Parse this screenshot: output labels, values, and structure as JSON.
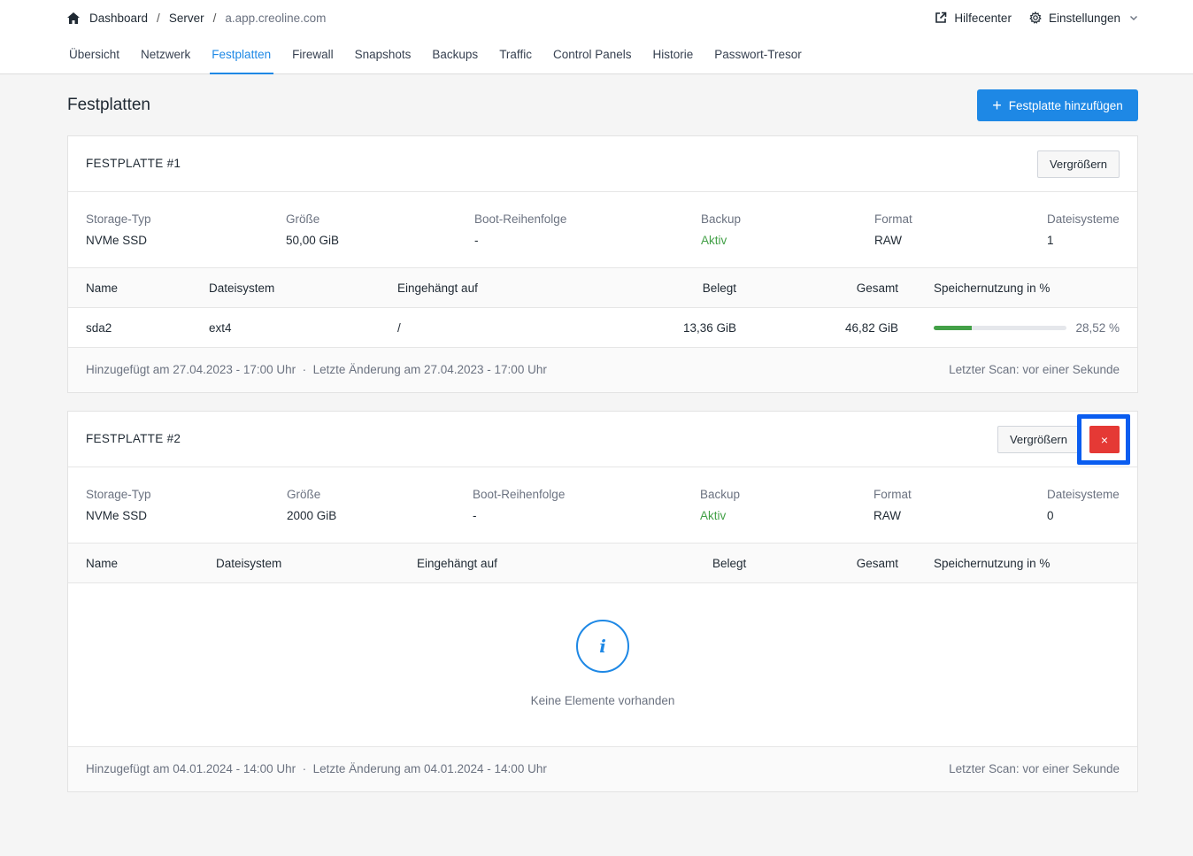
{
  "breadcrumb": {
    "home": "Dashboard",
    "section": "Server",
    "current": "a.app.creoline.com"
  },
  "header": {
    "help": "Hilfecenter",
    "settings": "Einstellungen"
  },
  "tabs": [
    {
      "label": "Übersicht"
    },
    {
      "label": "Netzwerk"
    },
    {
      "label": "Festplatten",
      "active": true
    },
    {
      "label": "Firewall"
    },
    {
      "label": "Snapshots"
    },
    {
      "label": "Backups"
    },
    {
      "label": "Traffic"
    },
    {
      "label": "Control Panels"
    },
    {
      "label": "Historie"
    },
    {
      "label": "Passwort-Tresor"
    }
  ],
  "page": {
    "title": "Festplatten",
    "add_button": "Festplatte hinzufügen"
  },
  "labels": {
    "storage_type": "Storage-Typ",
    "size": "Größe",
    "boot_order": "Boot-Reihenfolge",
    "backup": "Backup",
    "format": "Format",
    "filesystems": "Dateisysteme",
    "resize": "Vergrößern",
    "delete": "×",
    "col_name": "Name",
    "col_fs": "Dateisystem",
    "col_mount": "Eingehängt auf",
    "col_used": "Belegt",
    "col_total": "Gesamt",
    "col_usage": "Speichernutzung in %",
    "empty": "Keine Elemente vorhanden"
  },
  "disks": [
    {
      "title": "FESTPLATTE #1",
      "storage_type": "NVMe SSD",
      "size": "50,00 GiB",
      "boot_order": "-",
      "backup": "Aktiv",
      "format": "RAW",
      "filesystems": "1",
      "rows": [
        {
          "name": "sda2",
          "fs": "ext4",
          "mount": "/",
          "used": "13,36 GiB",
          "total": "46,82 GiB",
          "usage_text": "28,52 %",
          "usage": 28.52
        }
      ],
      "added": "Hinzugefügt am 27.04.2023 - 17:00 Uhr  ·  Letzte Änderung am 27.04.2023 - 17:00 Uhr",
      "scan": "Letzter Scan: vor einer Sekunde"
    },
    {
      "title": "FESTPLATTE #2",
      "storage_type": "NVMe SSD",
      "size": "2000 GiB",
      "boot_order": "-",
      "backup": "Aktiv",
      "format": "RAW",
      "filesystems": "0",
      "rows": [],
      "added": "Hinzugefügt am 04.01.2024 - 14:00 Uhr  ·  Letzte Änderung am 04.01.2024 - 14:00 Uhr",
      "scan": "Letzter Scan: vor einer Sekunde"
    }
  ],
  "colors": {
    "accent": "#1e88e5",
    "success": "#43a047",
    "danger": "#e53935",
    "highlight": "#0a5df0"
  }
}
